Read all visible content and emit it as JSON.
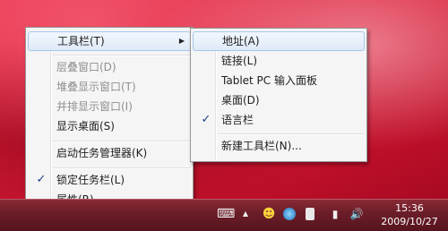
{
  "context_menu": {
    "items": [
      {
        "label": "工具栏(T)",
        "has_submenu": true,
        "highlighted": true
      },
      {
        "label": "层叠窗口(D)",
        "disabled": true
      },
      {
        "label": "堆叠显示窗口(T)",
        "disabled": true
      },
      {
        "label": "并排显示窗口(I)",
        "disabled": true
      },
      {
        "label": "显示桌面(S)"
      },
      {
        "label": "启动任务管理器(K)"
      },
      {
        "label": "锁定任务栏(L)",
        "checked": true
      },
      {
        "label": "属性(R)"
      }
    ]
  },
  "toolbars_submenu": {
    "items": [
      {
        "label": "地址(A)",
        "highlighted": true
      },
      {
        "label": "链接(L)"
      },
      {
        "label": "Tablet PC 输入面板"
      },
      {
        "label": "桌面(D)"
      },
      {
        "label": "语言栏",
        "checked": true
      },
      {
        "label": "新建工具栏(N)..."
      }
    ]
  },
  "glyphs": {
    "check": "✓",
    "submenu_arrow": "▶",
    "keyboard": "⌨",
    "tray_up": "▲",
    "chat": "☻",
    "network": "▮",
    "volume": "🔊"
  },
  "taskbar": {
    "time": "15:36",
    "date": "2009/10/27"
  }
}
